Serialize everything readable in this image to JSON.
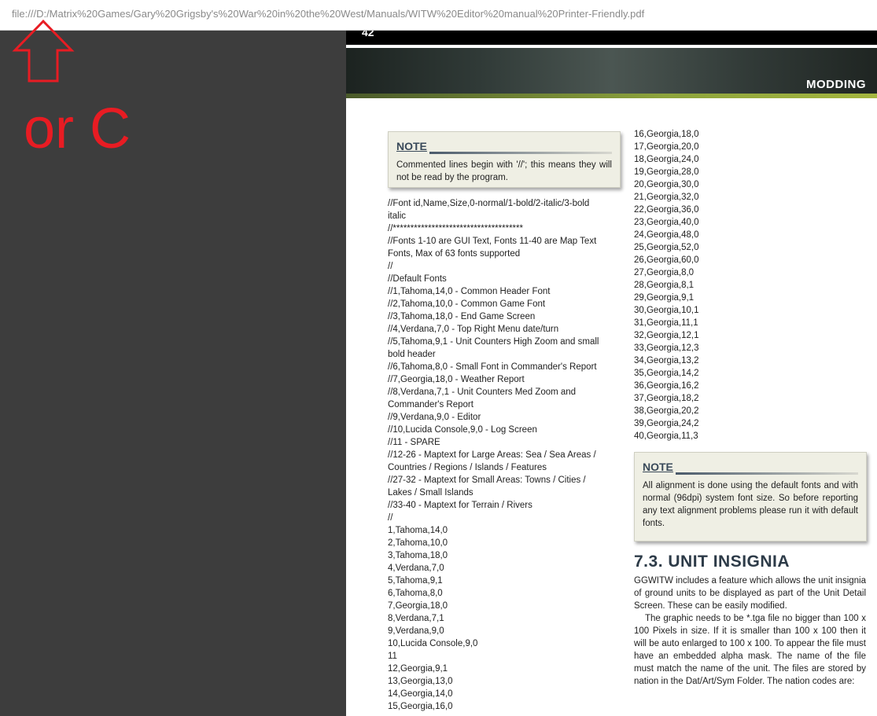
{
  "browser": {
    "url": "file:///D:/Matrix%20Games/Gary%20Grigsby's%20War%20in%20the%20West/Manuals/WITW%20Editor%20manual%20Printer-Friendly.pdf"
  },
  "annotation": {
    "arrow_color": "#e81c23",
    "text": "or C"
  },
  "page": {
    "page_number": "42",
    "header_title": "MODDING",
    "note1": {
      "title": "NOTE",
      "text": "Commented lines begin with '//'; this means they will not be read by the program."
    },
    "left_column": [
      "//Font id,Name,Size,0-normal/1-bold/2-italic/3-bold",
      "italic",
      "//*************************************",
      "//Fonts 1-10 are GUI Text, Fonts 11-40 are Map Text",
      "Fonts, Max of 63 fonts supported",
      "//",
      "//Default Fonts",
      "//1,Tahoma,14,0 - Common Header Font",
      "//2,Tahoma,10,0 - Common Game Font",
      "//3,Tahoma,18,0 - End Game Screen",
      "//4,Verdana,7,0 - Top Right Menu date/turn",
      "//5,Tahoma,9,1 - Unit Counters High Zoom and small",
      "bold header",
      "//6,Tahoma,8,0 - Small Font in Commander's Report",
      "//7,Georgia,18,0 - Weather Report",
      "//8,Verdana,7,1 - Unit Counters Med Zoom and",
      "Commander's Report",
      "//9,Verdana,9,0 - Editor",
      "//10,Lucida Console,9,0 - Log Screen",
      "//11 - SPARE",
      "//12-26 - Maptext for Large Areas: Sea / Sea Areas /",
      "Countries / Regions / Islands / Features",
      "//27-32 - Maptext for Small Areas: Towns / Cities /",
      "Lakes / Small Islands",
      "//33-40 - Maptext for Terrain / Rivers",
      "//",
      "1,Tahoma,14,0",
      "2,Tahoma,10,0",
      "3,Tahoma,18,0",
      "4,Verdana,7,0",
      "5,Tahoma,9,1",
      "6,Tahoma,8,0",
      "7,Georgia,18,0",
      "8,Verdana,7,1",
      "9,Verdana,9,0",
      "10,Lucida Console,9,0",
      "11",
      "12,Georgia,9,1",
      "13,Georgia,13,0",
      "14,Georgia,14,0",
      "15,Georgia,16,0"
    ],
    "right_column": [
      "16,Georgia,18,0",
      "17,Georgia,20,0",
      "18,Georgia,24,0",
      "19,Georgia,28,0",
      "20,Georgia,30,0",
      "21,Georgia,32,0",
      "22,Georgia,36,0",
      "23,Georgia,40,0",
      "24,Georgia,48,0",
      "25,Georgia,52,0",
      "26,Georgia,60,0",
      "27,Georgia,8,0",
      "28,Georgia,8,1",
      "29,Georgia,9,1",
      "30,Georgia,10,1",
      "31,Georgia,11,1",
      "32,Georgia,12,1",
      "33,Georgia,12,3",
      "34,Georgia,13,2",
      "35,Georgia,14,2",
      "36,Georgia,16,2",
      "37,Georgia,18,2",
      "38,Georgia,20,2",
      "39,Georgia,24,2",
      "40,Georgia,11,3"
    ],
    "note2": {
      "title": "NOTE",
      "text": "All alignment is done using the default fonts and with normal (96dpi) system font size. So before reporting any text alignment problems please run it with default fonts."
    },
    "section_title": "7.3. UNIT INSIGNIA",
    "paragraph1": "GGWITW includes a feature which allows the unit insignia of ground units to be displayed as part of the Unit Detail Screen. These can be easily modified.",
    "paragraph2": "The graphic needs to be *.tga file no bigger than 100 x 100 Pixels in size. If it is smaller than 100 x 100 then it will be auto enlarged to 100 x 100. To appear the file must have an embedded alpha mask. The name of the file must match the name of the unit. The files are stored by nation in the Dat/Art/Sym Folder. The nation codes are:"
  }
}
